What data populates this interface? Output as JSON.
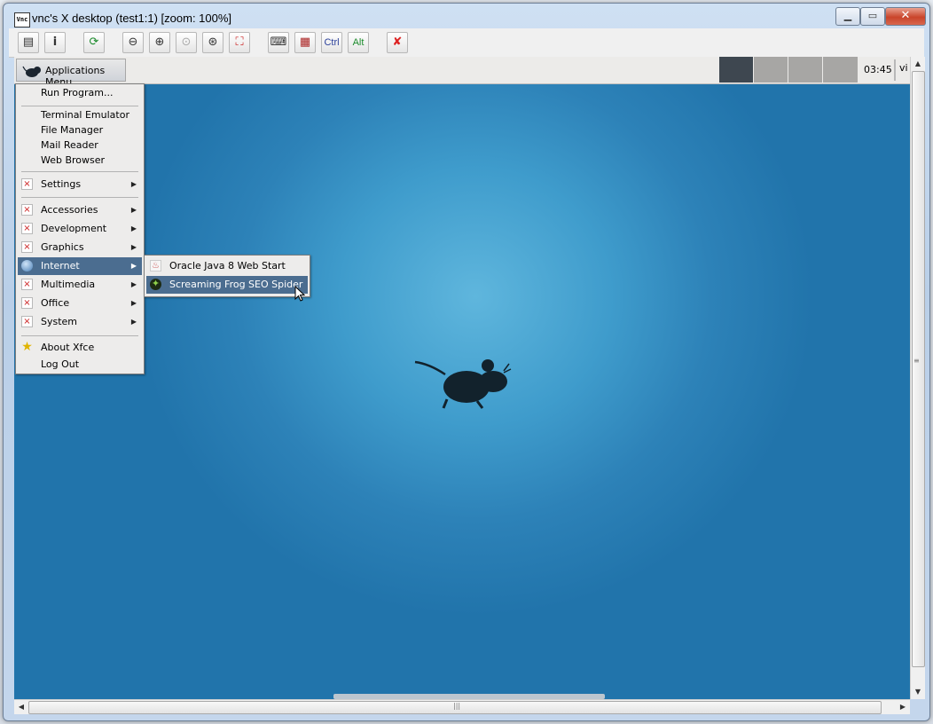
{
  "window": {
    "title": "vnc's X desktop (test1:1) [zoom: 100%]",
    "app_icon": "Vnc"
  },
  "toolbar": {
    "ctrl_label": "Ctrl",
    "alt_label": "Alt"
  },
  "panel": {
    "app_menu_label": "Applications Menu",
    "clock": "03:45",
    "tray_text": "vi"
  },
  "menu": {
    "run_program": "Run Program...",
    "terminal": "Terminal Emulator",
    "file_manager": "File Manager",
    "mail_reader": "Mail Reader",
    "web_browser": "Web Browser",
    "settings": "Settings",
    "accessories": "Accessories",
    "development": "Development",
    "graphics": "Graphics",
    "internet": "Internet",
    "multimedia": "Multimedia",
    "office": "Office",
    "system": "System",
    "about": "About Xfce",
    "logout": "Log Out"
  },
  "submenu": {
    "java": "Oracle Java 8 Web Start",
    "seo": "Screaming Frog SEO Spider"
  },
  "colors": {
    "menu_highlight": "#4b6d90",
    "desktop": "#2d82b8"
  }
}
